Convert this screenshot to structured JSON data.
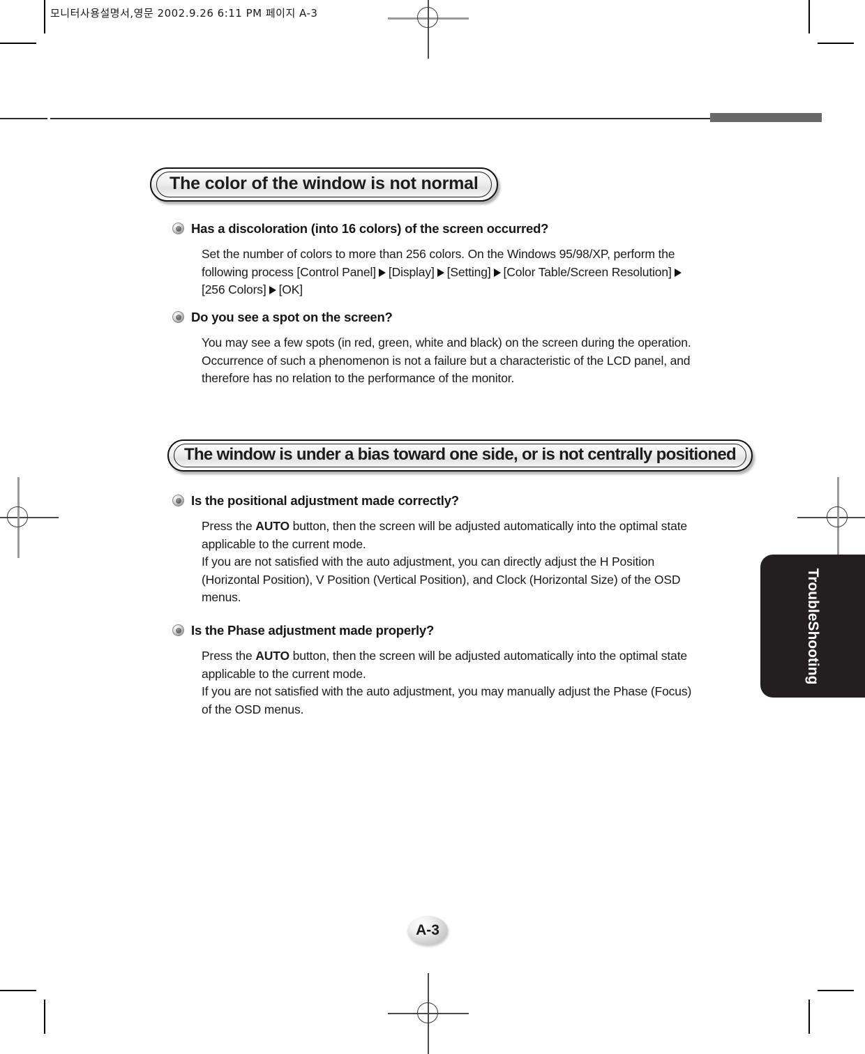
{
  "page": {
    "printer_slug": "모니터사용설명서,영문   2002.9.26 6:11 PM  페이지 A-3",
    "page_number": "A-3",
    "side_tab_label": "TroubleShooting",
    "accent_gray": "#696969",
    "tab_black": "#231f20"
  },
  "sections": [
    {
      "banner": "The color of the window is not normal",
      "items": [
        {
          "question": "Has a discoloration (into 16 colors) of the screen occurred?",
          "answer_parts": [
            {
              "type": "text",
              "value": "Set the number of colors to more than 256 colors. On the Windows 95/98/XP, perform the following process [Control Panel] "
            },
            {
              "type": "arrow",
              "value": "▶"
            },
            {
              "type": "text",
              "value": " [Display] "
            },
            {
              "type": "arrow",
              "value": "▶"
            },
            {
              "type": "text",
              "value": " [Setting] "
            },
            {
              "type": "arrow",
              "value": "▶"
            },
            {
              "type": "text",
              "value": " [Color Table/Screen Resolution] "
            },
            {
              "type": "arrow",
              "value": "▶"
            },
            {
              "type": "text",
              "value": " [256 Colors] "
            },
            {
              "type": "arrow",
              "value": "▶"
            },
            {
              "type": "text",
              "value": " [OK]"
            }
          ]
        },
        {
          "question": "Do you see a spot on the screen?",
          "answer": "You may see a few spots (in red, green, white and black) on the screen during the operation. Occurrence of such a phenomenon is not a failure but a characteristic of the LCD panel, and therefore has no relation to the performance of the monitor."
        }
      ]
    },
    {
      "banner": "The window is under a bias toward one side, or is not centrally positioned",
      "items": [
        {
          "question": "Is the positional adjustment made correctly?",
          "answer_lead": "Press the ",
          "answer_bold": "AUTO",
          "answer_rest": " button, then the screen will be adjusted automatically into the optimal state applicable to the current mode.",
          "answer_line2": "If you are not satisfied with the auto adjustment, you can directly adjust the H Position (Horizontal Position), V Position (Vertical Position), and Clock (Horizontal Size) of the OSD menus."
        },
        {
          "question": "Is the Phase adjustment made properly?",
          "answer_lead": "Press the ",
          "answer_bold": "AUTO",
          "answer_rest": " button, then the screen will be adjusted automatically into the optimal state applicable to the current mode.",
          "answer_line2": "If you are not satisfied with the auto adjustment, you may manually adjust the Phase (Focus) of the OSD menus."
        }
      ]
    }
  ]
}
